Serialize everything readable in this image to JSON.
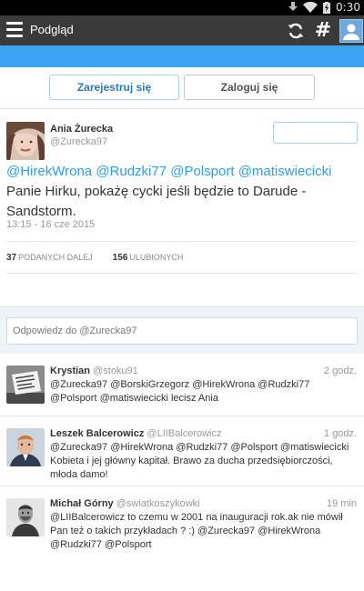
{
  "status_bar": {
    "time": "0:30"
  },
  "action_bar": {
    "title": "Podgląd"
  },
  "auth": {
    "register_label": "Zarejestruj się",
    "login_label": "Zaloguj się"
  },
  "tweet": {
    "author_name": "Ania Żurecka",
    "author_handle": "@Zurecka97",
    "mentions": [
      "@HirekWrona",
      "@Rudzki77",
      "@Polsport",
      "@matiswiecicki"
    ],
    "text": "Panie Hirku, pokażę cycki jeśli będzie to Darude - Sandstorm.",
    "time": "13:15 - 16 cze 2015",
    "retweets_count": "37",
    "retweets_label": "PODANYCH DALEJ",
    "favorites_count": "156",
    "favorites_label": "ULUBIONYCH"
  },
  "reply_box": {
    "placeholder": "Odpowiedz do @Zurecka97"
  },
  "replies": [
    {
      "name": "Krystian",
      "handle": "@stoku91",
      "time": "2 godz.",
      "text": "@Zurecka97 @BorskiGrzegorz @HirekWrona @Rudzki77 @Polsport @matiswiecicki lecisz Ania"
    },
    {
      "name": "Leszek Balcerowicz",
      "handle": "@LIIBalcerowicz",
      "time": "1 godz.",
      "text": "@Zurecka97 @HirekWrona @Rudzki77 @Polsport @matiswiecicki Kobieta i jej główny kapitał. Brawo za ducha przedsiębiorczości, młoda damo!"
    },
    {
      "name": "Michał Górny",
      "handle": "@swiatkoszykowki",
      "time": "19 min",
      "text": "@LIIBalcerowicz to czemu w 2001 na inauguracji rok.ak nie mówił Pan też o takich przykładach ? :) @Zurecka97 @HirekWrona @Rudzki77 @Polsport"
    }
  ],
  "colors": {
    "accent": "#3aa3f2",
    "link": "#2b9ef0",
    "action_bar": "#3a3a3a"
  }
}
